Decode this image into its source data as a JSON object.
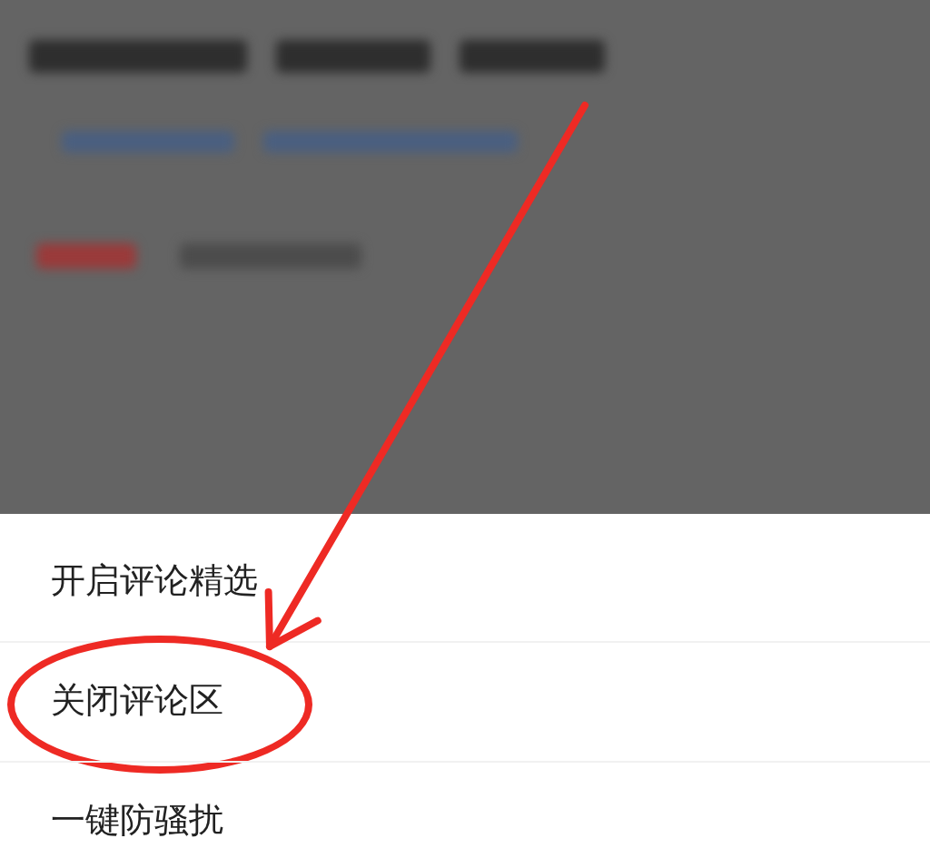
{
  "sheet": {
    "items": [
      {
        "label": "开启评论精选",
        "highlighted": false
      },
      {
        "label": "关闭评论区",
        "highlighted": true
      },
      {
        "label": "一键防骚扰",
        "highlighted": false
      }
    ]
  }
}
